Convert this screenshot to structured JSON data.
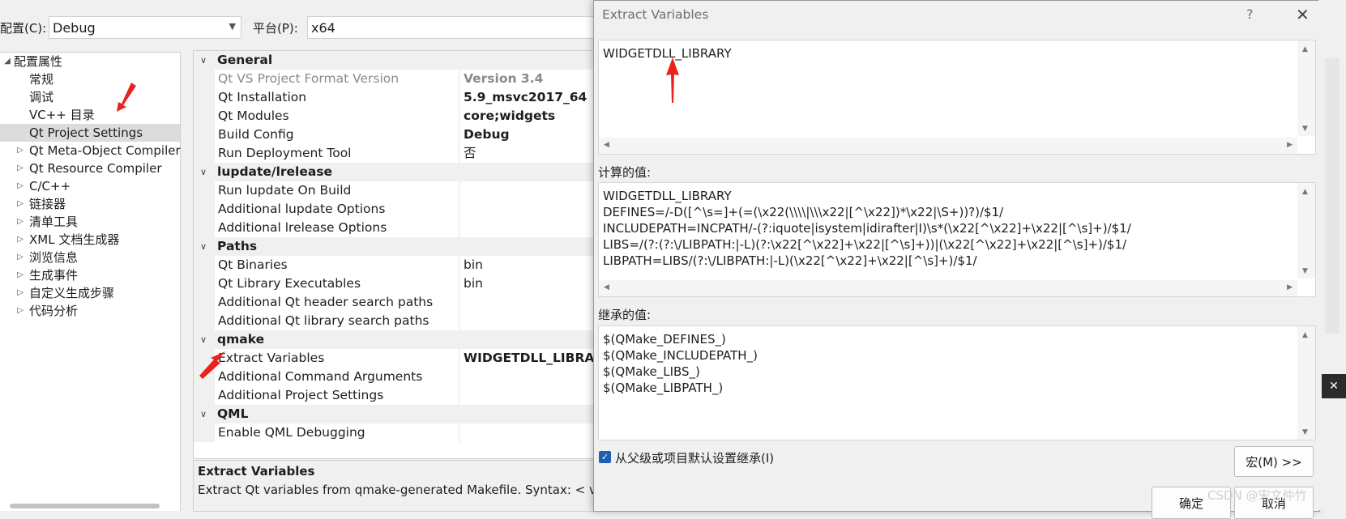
{
  "config": {
    "config_label": "配置(C):",
    "config_value": "Debug",
    "platform_label": "平台(P):",
    "platform_value": "x64"
  },
  "tree": {
    "root": "配置属性",
    "items": [
      "常规",
      "调试",
      "VC++ 目录",
      "Qt Project Settings",
      "Qt Meta-Object Compiler",
      "Qt Resource Compiler",
      "C/C++",
      "链接器",
      "清单工具",
      "XML 文档生成器",
      "浏览信息",
      "生成事件",
      "自定义生成步骤",
      "代码分析"
    ]
  },
  "grid": {
    "general": {
      "label": "General",
      "rows": [
        {
          "name": "Qt VS Project Format Version",
          "value": "Version 3.4"
        },
        {
          "name": "Qt Installation",
          "value": "5.9_msvc2017_64"
        },
        {
          "name": "Qt Modules",
          "value": "core;widgets"
        },
        {
          "name": "Build Config",
          "value": "Debug"
        },
        {
          "name": "Run Deployment Tool",
          "value": "否"
        }
      ]
    },
    "lupdate": {
      "label": "lupdate/lrelease",
      "rows": [
        {
          "name": "Run lupdate On Build",
          "value": ""
        },
        {
          "name": "Additional lupdate Options",
          "value": ""
        },
        {
          "name": "Additional lrelease Options",
          "value": ""
        }
      ]
    },
    "paths": {
      "label": "Paths",
      "rows": [
        {
          "name": "Qt Binaries",
          "value": "bin"
        },
        {
          "name": "Qt Library Executables",
          "value": "bin"
        },
        {
          "name": "Additional Qt header search paths",
          "value": ""
        },
        {
          "name": "Additional Qt library search paths",
          "value": ""
        }
      ]
    },
    "qmake": {
      "label": "qmake",
      "rows": [
        {
          "name": "Extract Variables",
          "value": "WIDGETDLL_LIBRARY"
        },
        {
          "name": "Additional Command Arguments",
          "value": ""
        },
        {
          "name": "Additional Project Settings",
          "value": ""
        }
      ]
    },
    "qml": {
      "label": "QML",
      "rows": [
        {
          "name": "Enable QML Debugging",
          "value": ""
        }
      ]
    }
  },
  "description": {
    "title": "Extract Variables",
    "text": "Extract Qt variables from qmake-generated Makefile. Syntax: < var_"
  },
  "dialog": {
    "title": "Extract Variables",
    "help": "?",
    "close": "✕",
    "input_value": "WIDGETDLL_LIBRARY",
    "computed_label": "计算的值:",
    "computed_lines": "WIDGETDLL_LIBRARY\nDEFINES=/-D([^\\s=]+(=(\\x22(\\\\\\\\|\\\\\\x22|[^\\x22])*\\x22|\\S+))?)/$1/\nINCLUDEPATH=INCPATH/-(?:iquote|isystem|idirafter|I)\\s*(\\x22[^\\x22]+\\x22|[^\\s]+)/$1/\nLIBS=/(?:(?:\\/LIBPATH:|-L)(?:\\x22[^\\x22]+\\x22|[^\\s]+))|(\\x22[^\\x22]+\\x22|[^\\s]+)/$1/\nLIBPATH=LIBS/(?:\\/LIBPATH:|-L)(\\x22[^\\x22]+\\x22|[^\\s]+)/$1/",
    "inherited_label": "继承的值:",
    "inherited_lines": "$(QMake_DEFINES_)\n$(QMake_INCLUDEPATH_)\n$(QMake_LIBS_)\n$(QMake_LIBPATH_)",
    "inherit_checkbox": "从父级或项目默认设置继承(I)",
    "inherit_checked": true,
    "macro_button": "宏(M) >>",
    "ok_button": "确定",
    "cancel_button": "取消"
  },
  "watermark": "CSDN @宋文仲竹",
  "colors": {
    "accent": "#1f5fb3",
    "annotation_arrow": "#e8231b",
    "selection": "#dcdcdc"
  }
}
